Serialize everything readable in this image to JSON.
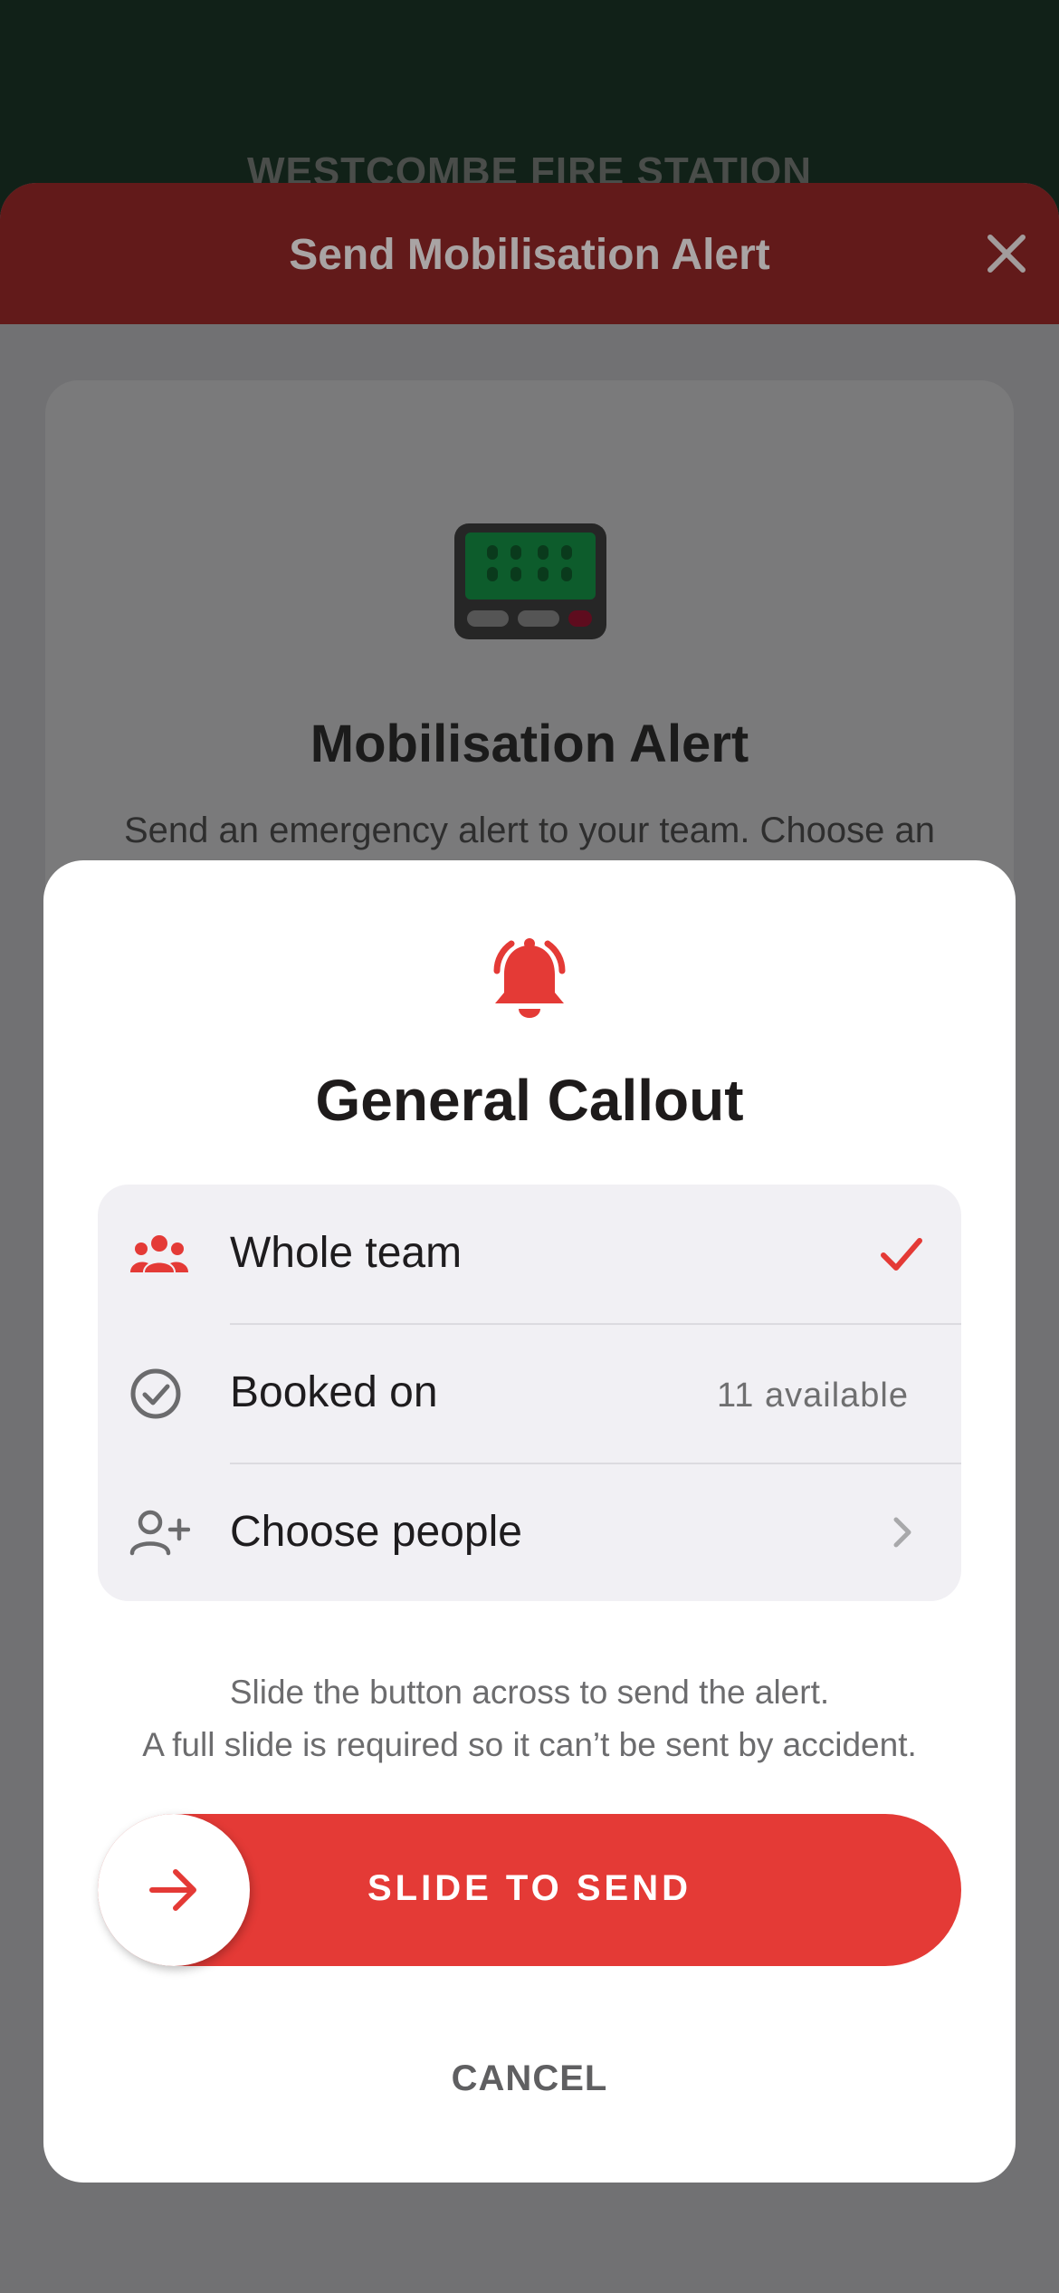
{
  "background": {
    "station_title": "WESTCOMBE FIRE STATION"
  },
  "sheet": {
    "title": "Send Mobilisation Alert",
    "close_icon": "close-icon",
    "card": {
      "icon": "pager-icon",
      "title": "Mobilisation Alert",
      "description": "Send an emergency alert to your team. Choose an alert below to confirm and send."
    }
  },
  "modal": {
    "icon": "bell-ringing-icon",
    "title": "General Callout",
    "options": [
      {
        "icon": "group-icon",
        "label": "Whole team",
        "detail": "",
        "selected": true
      },
      {
        "icon": "check-circle-icon",
        "label": "Booked on",
        "detail": "11 available",
        "selected": false
      },
      {
        "icon": "person-add-icon",
        "label": "Choose people",
        "detail": "",
        "selected": false
      }
    ],
    "hint_line1": "Slide the button across to send the alert.",
    "hint_line2": "A full slide is required so it can’t be sent by accident.",
    "slider_label": "SLIDE TO SEND",
    "cancel_label": "CANCEL"
  },
  "colors": {
    "accent_red": "#e43a36",
    "header_dark_red": "#621a1a",
    "app_header_green": "#112118"
  }
}
